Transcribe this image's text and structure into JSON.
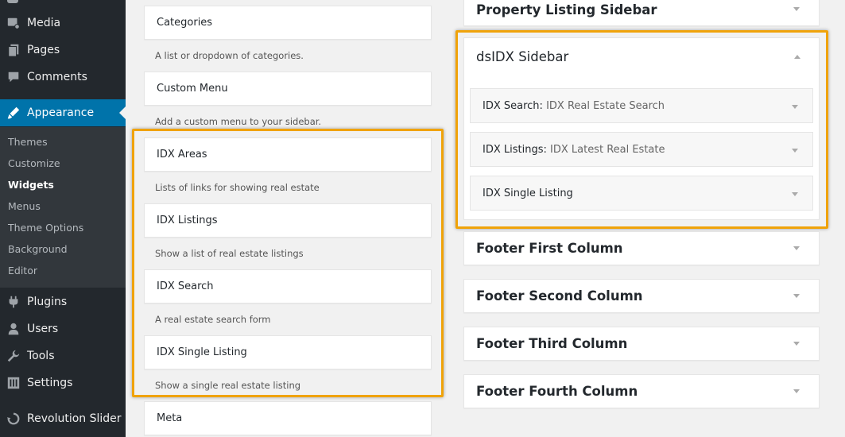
{
  "menu": {
    "items": [
      {
        "label": "Media",
        "icon": "media-icon"
      },
      {
        "label": "Pages",
        "icon": "pages-icon"
      },
      {
        "label": "Comments",
        "icon": "comments-icon"
      },
      {
        "label": "Appearance",
        "icon": "appearance-icon"
      },
      {
        "label": "Plugins",
        "icon": "plugins-icon"
      },
      {
        "label": "Users",
        "icon": "users-icon"
      },
      {
        "label": "Tools",
        "icon": "tools-icon"
      },
      {
        "label": "Settings",
        "icon": "settings-icon"
      },
      {
        "label": "Revolution Slider",
        "icon": "revolution-slider-icon"
      }
    ],
    "submenu": [
      "Themes",
      "Customize",
      "Widgets",
      "Menus",
      "Theme Options",
      "Background",
      "Editor"
    ],
    "current_item": "Appearance",
    "current_sub": "Widgets"
  },
  "available_widgets": [
    {
      "title": "Categories",
      "desc": "A list or dropdown of categories."
    },
    {
      "title": "Custom Menu",
      "desc": "Add a custom menu to your sidebar."
    },
    {
      "title": "IDX Areas",
      "desc": "Lists of links for showing real estate"
    },
    {
      "title": "IDX Listings",
      "desc": "Show a list of real estate listings"
    },
    {
      "title": "IDX Search",
      "desc": "A real estate search form"
    },
    {
      "title": "IDX Single Listing",
      "desc": "Show a single real estate listing"
    },
    {
      "title": "Meta",
      "desc": ""
    }
  ],
  "sidebars": {
    "property_listing": "Property Listing Sidebar",
    "dsidx": {
      "title": "dsIDX Sidebar",
      "widgets": [
        {
          "title": "IDX Search",
          "subtitle": "IDX Real Estate Search"
        },
        {
          "title": "IDX Listings",
          "subtitle": "IDX Latest Real Estate"
        },
        {
          "title": "IDX Single Listing",
          "subtitle": ""
        }
      ]
    },
    "footers": [
      "Footer First Column",
      "Footer Second Column",
      "Footer Third Column",
      "Footer Fourth Column"
    ]
  },
  "colors": {
    "admin_menu_bg": "#23282d",
    "submenu_bg": "#32373c",
    "accent": "#0073aa",
    "highlight": "#f0a30a"
  }
}
